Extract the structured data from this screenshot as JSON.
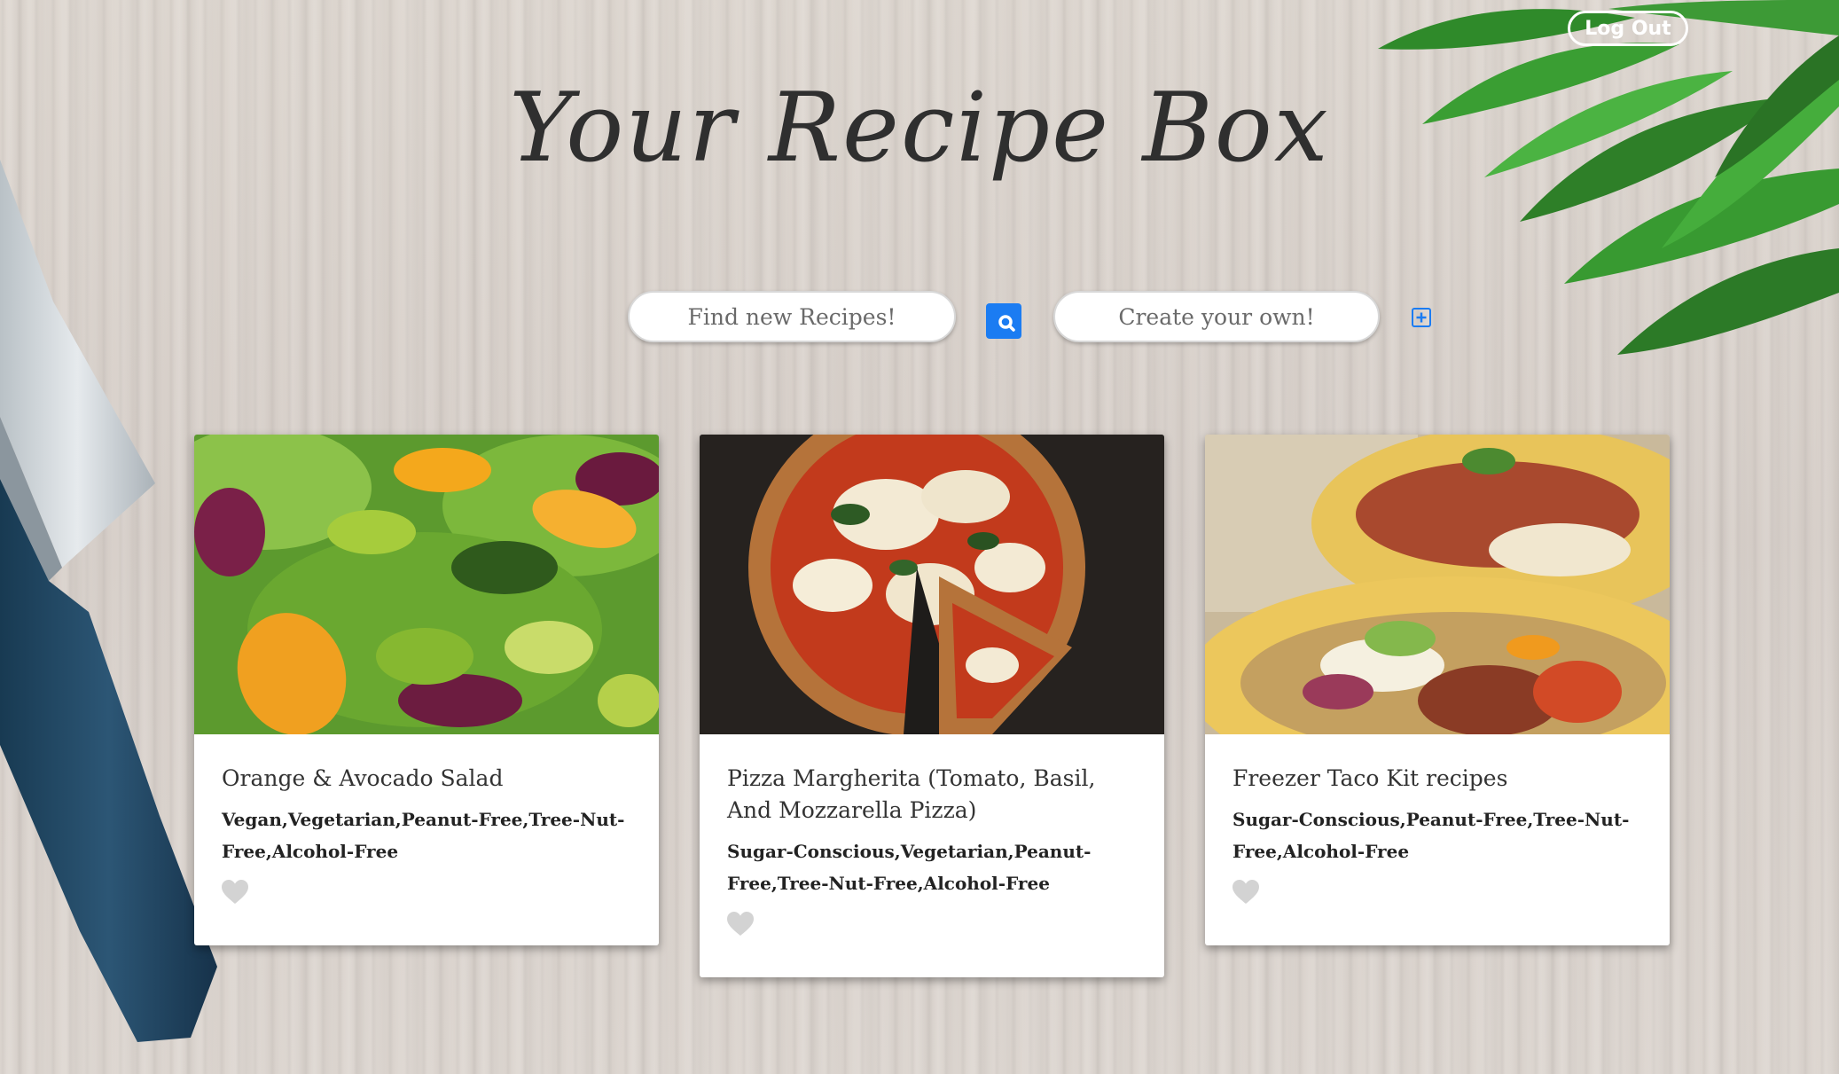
{
  "header": {
    "title": "Your Recipe Box",
    "logout_label": "Log Out"
  },
  "search": {
    "find_placeholder": "Find new Recipes!",
    "create_placeholder": "Create your own!"
  },
  "icons": {
    "search": "search-icon",
    "add": "plus-square-icon",
    "favorite": "heart-icon"
  },
  "colors": {
    "accent": "#1b7cf2",
    "heart": "#d3d3d3",
    "title": "#2f2f2f"
  },
  "recipes": [
    {
      "title": "Orange & Avocado Salad",
      "tags": "Vegan,Vegetarian,Peanut-Free,Tree-Nut-Free,Alcohol-Free",
      "favorited": false
    },
    {
      "title": "Pizza Margherita (Tomato, Basil, And Mozzarella Pizza)",
      "tags": "Sugar-Conscious,Vegetarian,Peanut-Free,Tree-Nut-Free,Alcohol-Free",
      "favorited": false
    },
    {
      "title": "Freezer Taco Kit recipes",
      "tags": "Sugar-Conscious,Peanut-Free,Tree-Nut-Free,Alcohol-Free",
      "favorited": false
    }
  ]
}
